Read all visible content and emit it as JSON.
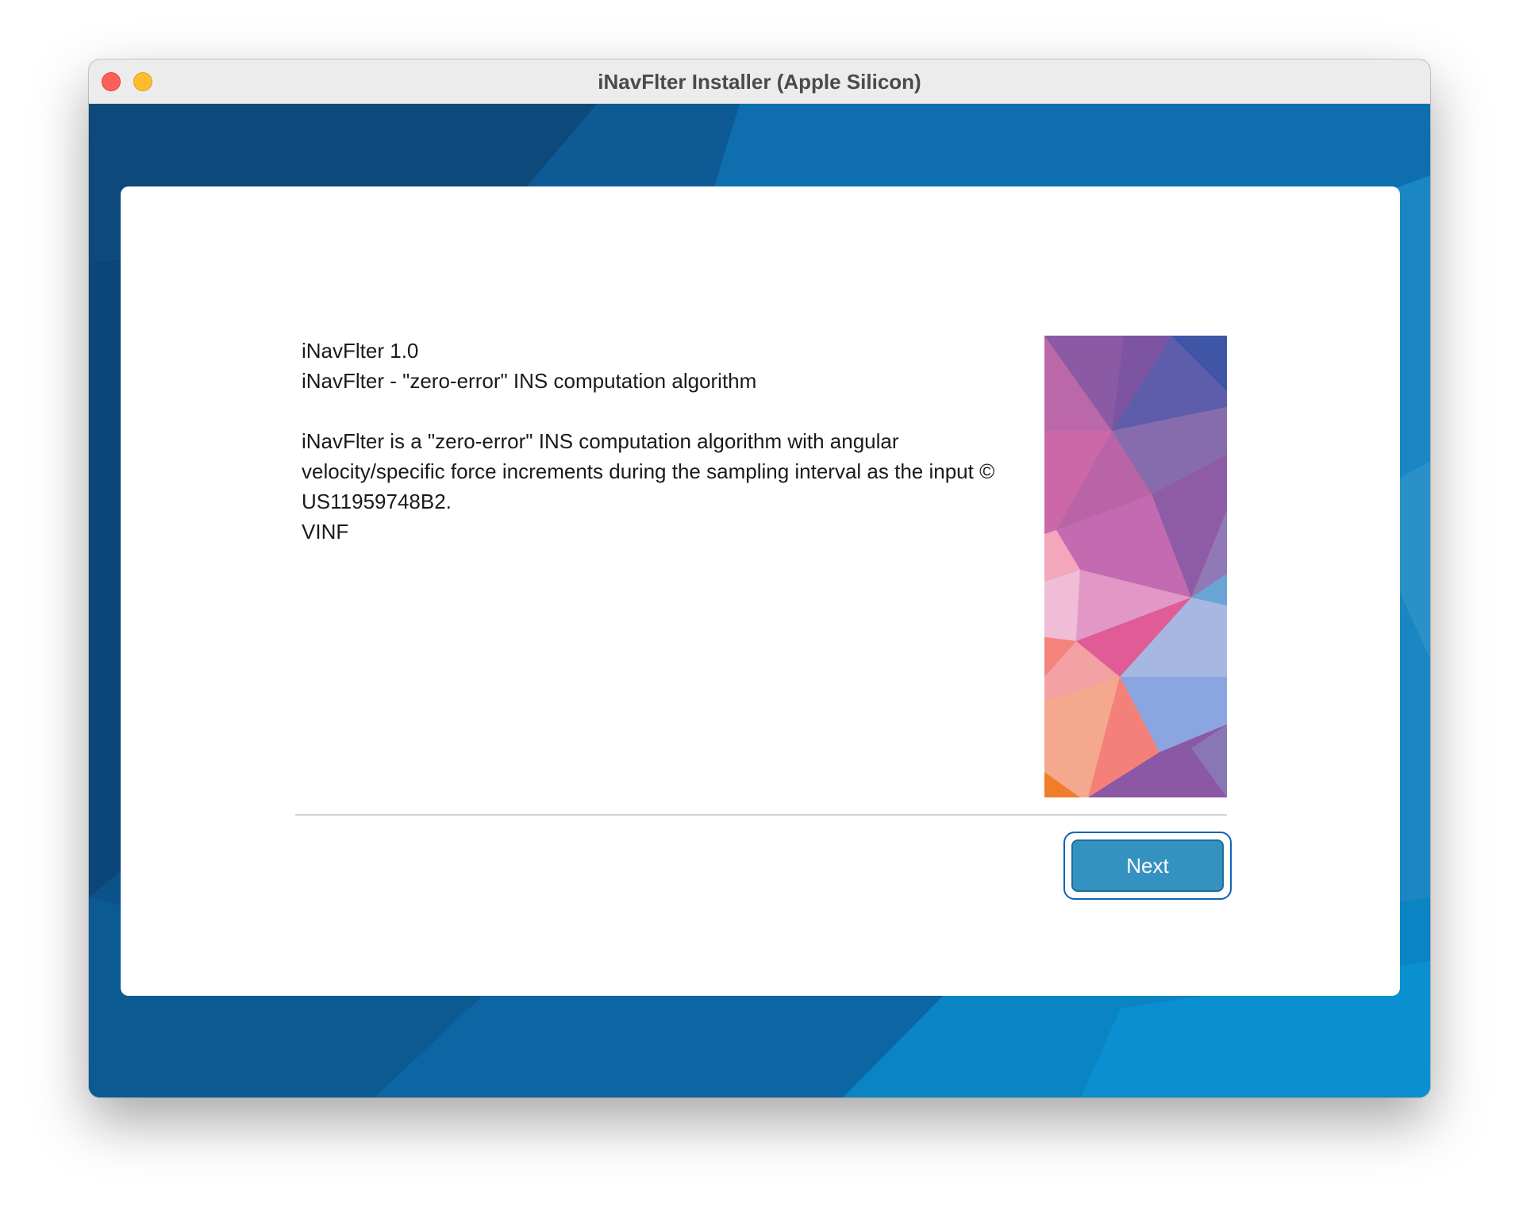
{
  "window": {
    "title": "iNavFlter Installer (Apple Silicon)"
  },
  "content": {
    "line1": "iNavFlter 1.0",
    "line2": "iNavFlter - \"zero-error\" INS computation algorithm",
    "line3": "iNavFlter is a \"zero-error\" INS computation algorithm with angular",
    "line4": "velocity/specific force increments during the sampling interval as the input ©",
    "line5": "US11959748B2.",
    "line6": "VINF"
  },
  "buttons": {
    "next_label": "Next"
  },
  "colors": {
    "backdrop": "#0a4f86",
    "button": "#3592c0",
    "focus_ring": "#0e63b8"
  },
  "icons": {
    "close": "close-icon",
    "minimize": "minimize-icon",
    "art": "polygon-art"
  }
}
